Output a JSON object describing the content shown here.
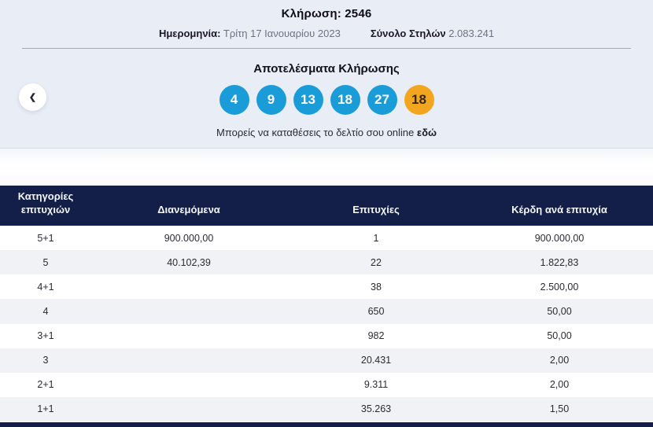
{
  "header": {
    "draw_title": "Κλήρωση: 2546",
    "date_label": "Ημερομηνία:",
    "date_value": "Τρίτη 17 Ιανουαρίου 2023",
    "columns_label": "Σύνολο Στηλών",
    "columns_value": "2.083.241"
  },
  "results": {
    "title": "Αποτελέσματα Κλήρωσης",
    "online_text": "Μπορείς να καταθέσεις το δελτίο σου online",
    "online_link_label": "εδώ"
  },
  "numbers": {
    "main": [
      "4",
      "9",
      "13",
      "18",
      "27"
    ],
    "tzoker": "18"
  },
  "nav": {
    "prev_icon": "❮"
  },
  "colors": {
    "section_bg": "#e9edf5",
    "navy": "#131f48",
    "ball_blue": "#1a9cd9",
    "ball_orange": "#f2a61f"
  },
  "table": {
    "headers": {
      "category": "Κατηγορίες επιτυχιών",
      "distributed": "Διανεμόμενα",
      "winners": "Επιτυχίες",
      "prize": "Κέρδη ανά επιτυχία"
    },
    "rows": [
      {
        "category": "5+1",
        "distributed": "900.000,00",
        "winners": "1",
        "prize": "900.000,00"
      },
      {
        "category": "5",
        "distributed": "40.102,39",
        "winners": "22",
        "prize": "1.822,83"
      },
      {
        "category": "4+1",
        "distributed": "",
        "winners": "38",
        "prize": "2.500,00"
      },
      {
        "category": "4",
        "distributed": "",
        "winners": "650",
        "prize": "50,00"
      },
      {
        "category": "3+1",
        "distributed": "",
        "winners": "982",
        "prize": "50,00"
      },
      {
        "category": "3",
        "distributed": "",
        "winners": "20.431",
        "prize": "2,00"
      },
      {
        "category": "2+1",
        "distributed": "",
        "winners": "9.311",
        "prize": "2,00"
      },
      {
        "category": "1+1",
        "distributed": "",
        "winners": "35.263",
        "prize": "1,50"
      }
    ]
  }
}
